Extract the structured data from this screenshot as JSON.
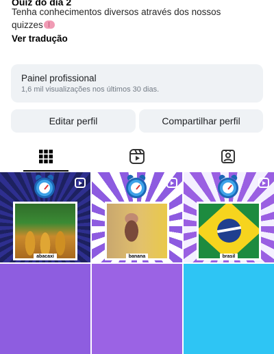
{
  "bio": {
    "title": "Quiz do dia 2",
    "line1": "Tenha conhecimentos diversos através dos nossos",
    "line2": "quizzes",
    "translate": "Ver tradução"
  },
  "pro_panel": {
    "title": "Painel profissional",
    "subtitle": "1,6 mil visualizações nos últimos 30 dias."
  },
  "buttons": {
    "edit": "Editar perfil",
    "share": "Compartilhar perfil"
  },
  "tabs": {
    "icons": [
      "grid-icon",
      "reels-icon",
      "tagged-icon"
    ],
    "active": "grid"
  },
  "grid": {
    "posts": [
      {
        "label": "abacaxi"
      },
      {
        "label": "banana"
      },
      {
        "label": "brasil"
      }
    ]
  }
}
